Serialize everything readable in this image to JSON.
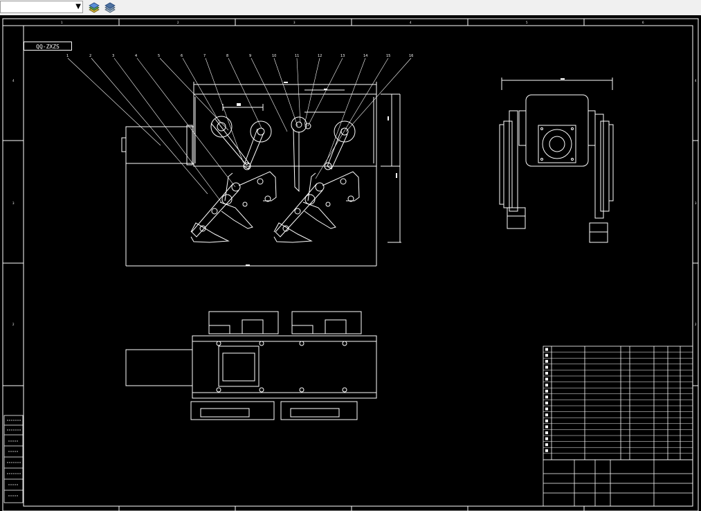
{
  "toolbar": {
    "layer_combo_value": "",
    "icons": [
      "layer-state-icon",
      "layer-previous-icon"
    ]
  },
  "drawing": {
    "drawing_id": "QQ-ZXZS",
    "colors": {
      "background": "#000000",
      "lines": "#ffffff"
    },
    "balloons": [
      "1",
      "2",
      "3",
      "4",
      "5",
      "6",
      "7",
      "8",
      "9",
      "10",
      "11",
      "12",
      "13",
      "14",
      "15",
      "16"
    ]
  }
}
